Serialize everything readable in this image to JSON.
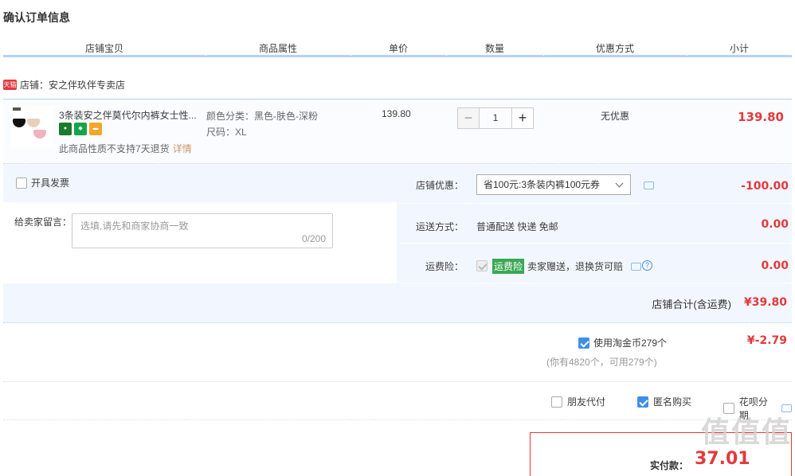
{
  "page_title": "确认订单信息",
  "columns": [
    "店铺宝贝",
    "商品属性",
    "单价",
    "数量",
    "优惠方式",
    "小计"
  ],
  "shop": {
    "badge": "天猫",
    "label": "店铺：安之伴玖伴专卖店"
  },
  "item": {
    "name": "3条装安之伴莫代尔内裤女士性...",
    "badges": [
      {
        "icon": "tmall-cat-icon",
        "color": "#1a7a2a"
      },
      {
        "icon": "shield-icon",
        "color": "#16a34a"
      },
      {
        "icon": "credit-card-icon",
        "color": "#f4a62a"
      }
    ],
    "return_note": "此商品性质不支持7天退货",
    "details_link": "详情",
    "attr_color": "颜色分类：黑色-肤色-深粉",
    "attr_size": "尺码：XL",
    "price": "139.80",
    "quantity": "1",
    "minus": "−",
    "plus": "+",
    "discount": "无优惠",
    "subtotal": "139.80"
  },
  "invoice": {
    "label": "开具发票"
  },
  "message": {
    "label": "给卖家留言：",
    "placeholder": "选填,请先和商家协商一致",
    "counter": "0/200"
  },
  "shop_discount": {
    "label": "店铺优惠：",
    "selected": "省100元:3条装内裤100元券",
    "amount": "-100.00"
  },
  "shipping": {
    "label": "运送方式：",
    "value": "普通配送 快递 免邮",
    "amount": "0.00"
  },
  "insurance": {
    "label": "运费险：",
    "tag": "运费险",
    "desc": "卖家赠送，退换货可赔",
    "help": "?",
    "amount": "0.00"
  },
  "shop_total": {
    "label": "店铺合计(含运费)",
    "amount": "¥39.80"
  },
  "coins": {
    "label": "使用淘金币279个",
    "sub": "(你有4820个，可用279个)",
    "amount": "¥-2.79"
  },
  "pay_options": [
    {
      "label": "朋友代付",
      "checked": false
    },
    {
      "label": "匿名购买",
      "checked": true
    },
    {
      "label": "花呗分期",
      "checked": false
    }
  ],
  "final": {
    "label": "实付款：",
    "amount": "37.01"
  },
  "watermark": "值值值",
  "colors": {
    "accent_red": "#e4393c",
    "header_line": "#b2d1ff",
    "panel_bg": "#f2f7ff",
    "check_blue": "#3f8fe6"
  }
}
